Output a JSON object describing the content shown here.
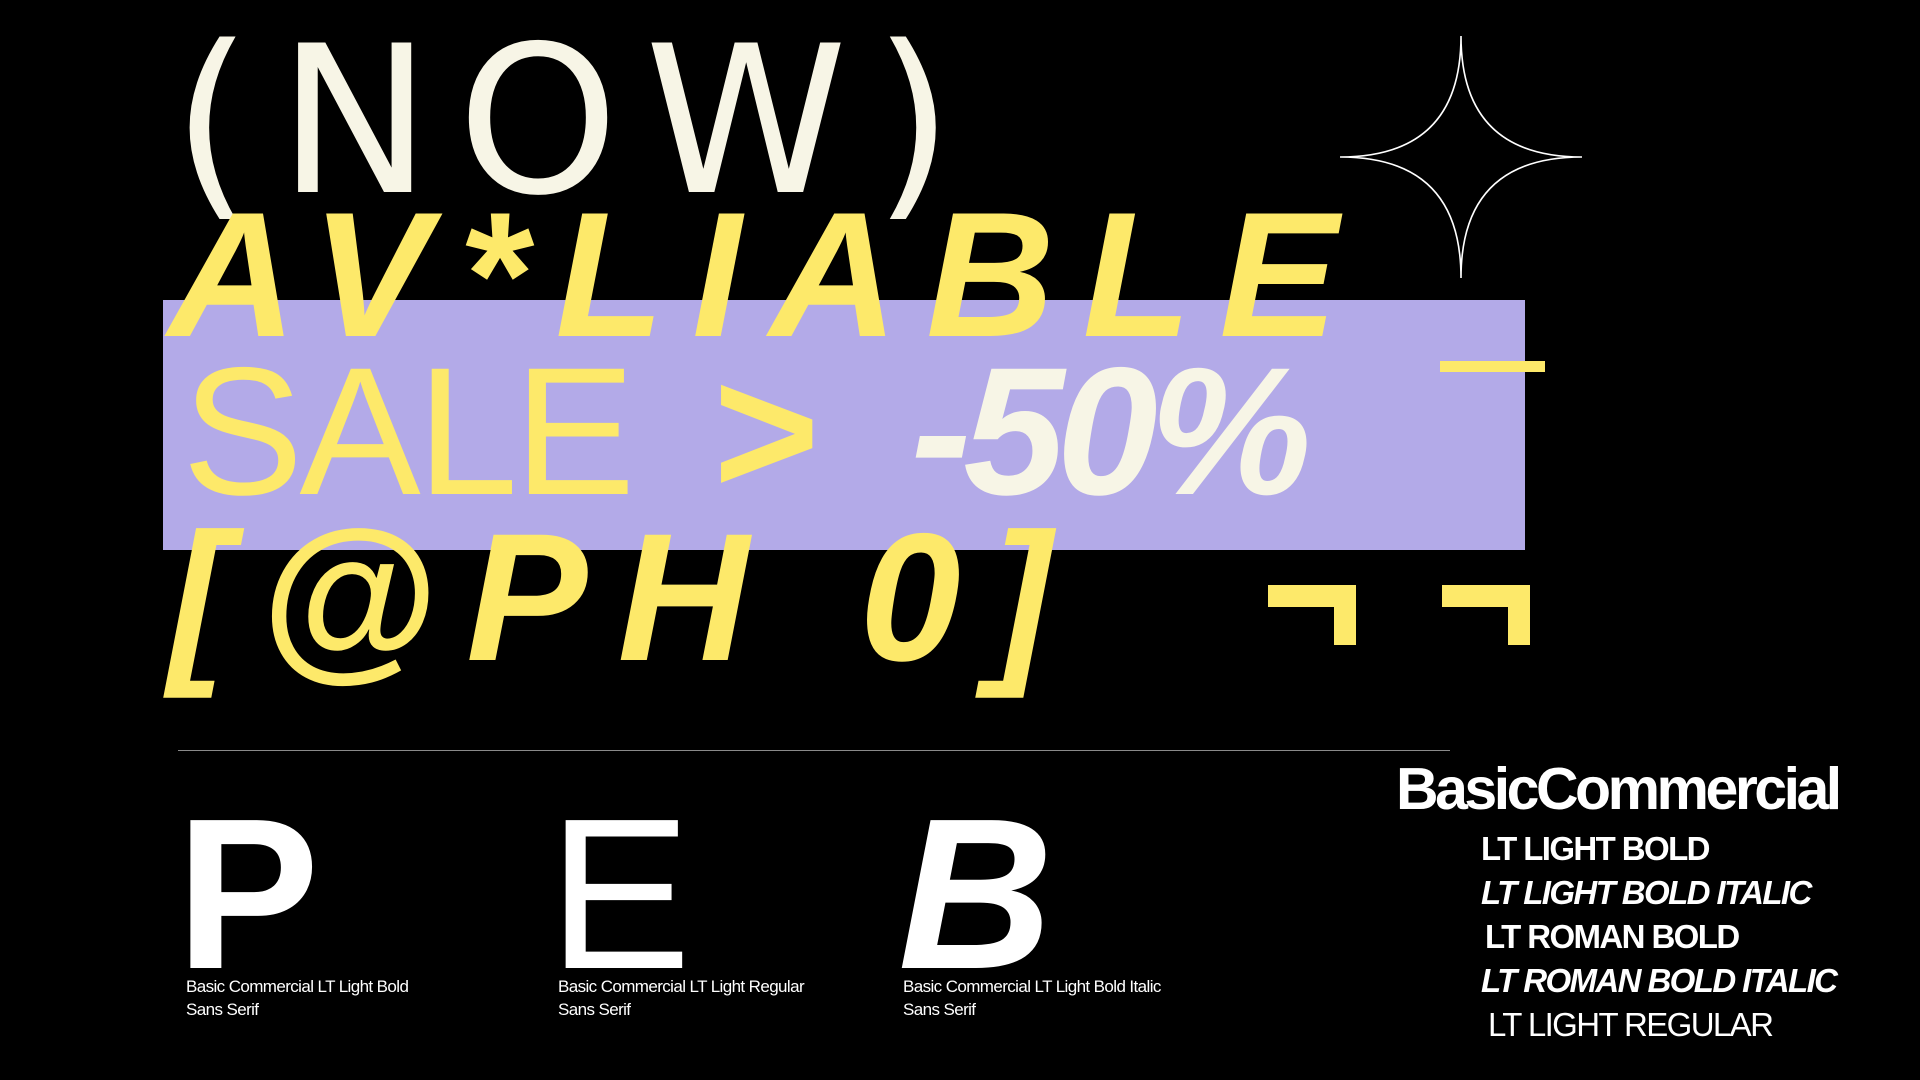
{
  "hero": {
    "line1": "(NOW)",
    "line2": "AV*LIABLE",
    "sale_word": "SALE",
    "arrow": ">",
    "discount": "-50%",
    "line4": "[@PH 0]"
  },
  "specimens": [
    {
      "glyph": "P",
      "font_name": "Basic Commercial LT Light Bold",
      "category": "Sans Serif"
    },
    {
      "glyph": "E",
      "font_name": "Basic Commercial LT Light Regular",
      "category": "Sans Serif"
    },
    {
      "glyph": "B",
      "font_name": "Basic Commercial LT Light Bold Italic",
      "category": "Sans Serif"
    }
  ],
  "family": {
    "name": "BasicCommercial",
    "weights": [
      "LT LIGHT BOLD",
      "LT LIGHT BOLD ITALIC",
      "LT ROMAN BOLD",
      "LT ROMAN BOLD ITALIC",
      "LT LIGHT REGULAR"
    ]
  },
  "colors": {
    "background": "#000000",
    "yellow": "#fde96a",
    "lilac": "#b3aae8",
    "cream": "#f7f5e6",
    "white": "#ffffff"
  },
  "icons": {
    "sparkle": "four-point-star-outline",
    "corner_marks": "yellow-corner-bracket"
  }
}
